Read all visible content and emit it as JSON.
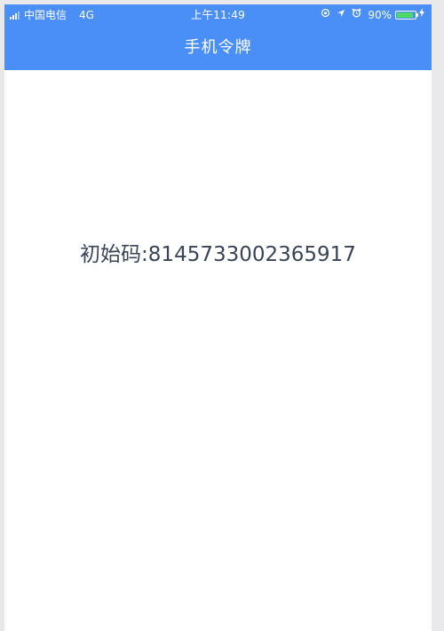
{
  "status_bar": {
    "carrier": "中国电信",
    "network": "4G",
    "time": "上午11:49",
    "battery_percent": "90%",
    "battery_level": 0.9,
    "icons": [
      "signal-bars-icon",
      "rotation-lock-icon",
      "location-arrow-icon",
      "alarm-clock-icon",
      "battery-icon",
      "charging-bolt-icon"
    ]
  },
  "navbar": {
    "title": "手机令牌"
  },
  "content": {
    "code_label": "初始码:",
    "code_value": "8145733002365917"
  },
  "colors": {
    "header_bg": "#4a8ff7",
    "header_text": "#ffffff",
    "body_text": "#3b4456",
    "battery_fill": "#4cd964",
    "page_bg": "#ffffff"
  }
}
